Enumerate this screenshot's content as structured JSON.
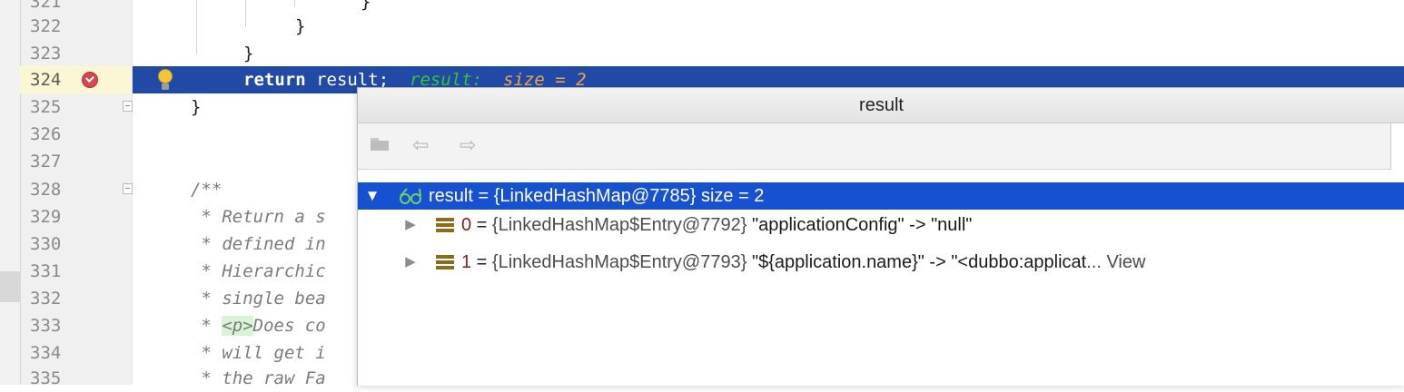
{
  "editor": {
    "lines": [
      {
        "num": "321",
        "code": "}"
      },
      {
        "num": "322",
        "code": "}"
      },
      {
        "num": "323",
        "code": "}"
      },
      {
        "num": "324",
        "keyword": "return",
        "code": " result;",
        "inline_name": "result:",
        "inline_value": "size = 2"
      },
      {
        "num": "325",
        "code": "}"
      },
      {
        "num": "326",
        "code": ""
      },
      {
        "num": "327",
        "code": ""
      },
      {
        "num": "328",
        "code": "/**"
      },
      {
        "num": "329",
        "code": " * Return a s"
      },
      {
        "num": "330",
        "code": " * defined in"
      },
      {
        "num": "331",
        "code": " * Hierarchic"
      },
      {
        "num": "332",
        "code": " * single bea"
      },
      {
        "num": "333",
        "prefix": " * ",
        "tag": "<p>",
        "code": "Does co"
      },
      {
        "num": "334",
        "code": " * will get i"
      },
      {
        "num": "335",
        "code": " * the raw Fa"
      }
    ]
  },
  "popup": {
    "title": "result",
    "rows": [
      {
        "name": "result",
        "op": " = ",
        "ref": "{LinkedHashMap@7785}",
        "extra": "  size = 2"
      },
      {
        "index": "0",
        "op": " = ",
        "ref": "{LinkedHashMap$Entry@7792}",
        "value": " \"applicationConfig\" -> \"null\""
      },
      {
        "index": "1",
        "op": " = ",
        "ref": "{LinkedHashMap$Entry@7793}",
        "value": " \"${application.name}\" -> \"<dubbo:applicat",
        "ellipsis": "... ",
        "view": "View"
      }
    ]
  },
  "colors": {
    "current_line_bg": "#2149a6",
    "selection_bg": "#1551d0",
    "breakpoint": "#d8464d",
    "inline_name": "#37c437",
    "inline_value": "#f0a24a"
  }
}
